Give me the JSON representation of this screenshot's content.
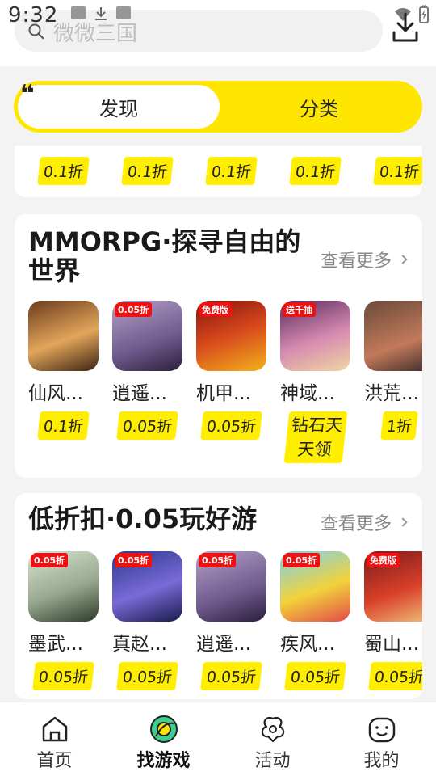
{
  "status_bar": {
    "time": "9:32"
  },
  "search": {
    "placeholder": "微微三国"
  },
  "tabs": [
    {
      "label": "发现",
      "active": true
    },
    {
      "label": "分类",
      "active": false
    }
  ],
  "top_row": {
    "badges": [
      "0.1折",
      "0.1折",
      "0.1折",
      "0.1折",
      "0.1折"
    ]
  },
  "sections": [
    {
      "title": "MMORPG·探寻自由的世界",
      "more": "查看更多",
      "games": [
        {
          "name": "仙风...",
          "badge": "0.1折",
          "icon_tag": ""
        },
        {
          "name": "逍遥...",
          "badge": "0.05折",
          "icon_tag": "0.05折"
        },
        {
          "name": "机甲...",
          "badge": "0.05折",
          "icon_tag": "免费版"
        },
        {
          "name": "神域...",
          "badge": "钻石天天领",
          "icon_tag": "送千抽"
        },
        {
          "name": "洪荒...",
          "badge": "1折",
          "icon_tag": ""
        }
      ]
    },
    {
      "title": "低折扣·0.05玩好游",
      "more": "查看更多",
      "games": [
        {
          "name": "墨武...",
          "badge": "0.05折",
          "icon_tag": "0.05折"
        },
        {
          "name": "真赵...",
          "badge": "0.05折",
          "icon_tag": "0.05折"
        },
        {
          "name": "逍遥...",
          "badge": "0.05折",
          "icon_tag": "0.05折"
        },
        {
          "name": "疾风...",
          "badge": "0.05折",
          "icon_tag": "0.05折"
        },
        {
          "name": "蜀山...",
          "badge": "0.05折",
          "icon_tag": "免费版"
        }
      ]
    }
  ],
  "nav": [
    {
      "label": "首页",
      "icon": "home-icon",
      "active": false
    },
    {
      "label": "找游戏",
      "icon": "find-game-icon",
      "active": true
    },
    {
      "label": "活动",
      "icon": "activity-icon",
      "active": false
    },
    {
      "label": "我的",
      "icon": "profile-icon",
      "active": false
    }
  ],
  "colors": {
    "accent": "#ffe600",
    "badge": "#ffee00",
    "background": "#f3f3f3"
  }
}
